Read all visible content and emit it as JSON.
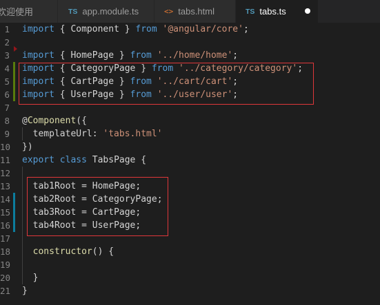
{
  "tabs": [
    {
      "label": "欢迎使用",
      "icon": "none",
      "active": false
    },
    {
      "label": "app.module.ts",
      "icon": "TS",
      "active": false
    },
    {
      "label": "tabs.html",
      "icon": "<>",
      "active": false
    },
    {
      "label": "tabs.ts",
      "icon": "TS",
      "active": true
    }
  ],
  "colors": {
    "background": "#1e1e1e",
    "keyword": "#569cd6",
    "type": "#4ec9b0",
    "string": "#ce9178",
    "function": "#dcdcaa",
    "property": "#9cdcfe",
    "highlight_box": "#e0373a"
  },
  "lines": [
    {
      "n": "1",
      "parts": [
        [
          "kw",
          "import"
        ],
        [
          "plain",
          " { "
        ],
        [
          "plain",
          "Component"
        ],
        [
          "plain",
          " } "
        ],
        [
          "kw",
          "from"
        ],
        [
          "plain",
          " "
        ],
        [
          "str",
          "'@angular/core'"
        ],
        [
          "plain",
          ";"
        ]
      ]
    },
    {
      "n": "2",
      "parts": []
    },
    {
      "n": "3",
      "parts": [
        [
          "kw",
          "import"
        ],
        [
          "plain",
          " { "
        ],
        [
          "plain",
          "HomePage"
        ],
        [
          "plain",
          " } "
        ],
        [
          "kw",
          "from"
        ],
        [
          "plain",
          " "
        ],
        [
          "str",
          "'../home/home'"
        ],
        [
          "plain",
          ";"
        ]
      ]
    },
    {
      "n": "4",
      "parts": [
        [
          "kw",
          "import"
        ],
        [
          "plain",
          " { "
        ],
        [
          "plain",
          "CategoryPage"
        ],
        [
          "plain",
          " } "
        ],
        [
          "kw",
          "from"
        ],
        [
          "plain",
          " "
        ],
        [
          "str",
          "'../category/category'"
        ],
        [
          "plain",
          ";"
        ]
      ]
    },
    {
      "n": "5",
      "parts": [
        [
          "kw",
          "import"
        ],
        [
          "plain",
          " { "
        ],
        [
          "plain",
          "CartPage"
        ],
        [
          "plain",
          " } "
        ],
        [
          "kw",
          "from"
        ],
        [
          "plain",
          " "
        ],
        [
          "str",
          "'../cart/cart'"
        ],
        [
          "plain",
          ";"
        ]
      ]
    },
    {
      "n": "6",
      "parts": [
        [
          "kw",
          "import"
        ],
        [
          "plain",
          " { "
        ],
        [
          "plain",
          "UserPage"
        ],
        [
          "plain",
          " } "
        ],
        [
          "kw",
          "from"
        ],
        [
          "plain",
          " "
        ],
        [
          "str",
          "'../user/user'"
        ],
        [
          "plain",
          ";"
        ]
      ]
    },
    {
      "n": "7",
      "parts": []
    },
    {
      "n": "8",
      "parts": [
        [
          "plain",
          "@"
        ],
        [
          "fn",
          "Component"
        ],
        [
          "plain",
          "({"
        ]
      ]
    },
    {
      "n": "9",
      "parts": [
        [
          "plain",
          "  "
        ],
        [
          "plain",
          "templateUrl"
        ],
        [
          "plain",
          ": "
        ],
        [
          "str",
          "'tabs.html'"
        ]
      ]
    },
    {
      "n": "10",
      "parts": [
        [
          "plain",
          "})"
        ]
      ]
    },
    {
      "n": "11",
      "parts": [
        [
          "kw",
          "export"
        ],
        [
          "plain",
          " "
        ],
        [
          "kw",
          "class"
        ],
        [
          "plain",
          " "
        ],
        [
          "plain",
          "TabsPage"
        ],
        [
          "plain",
          " {"
        ]
      ]
    },
    {
      "n": "12",
      "parts": []
    },
    {
      "n": "13",
      "parts": [
        [
          "plain",
          "  "
        ],
        [
          "plain",
          "tab1Root"
        ],
        [
          "plain",
          " = "
        ],
        [
          "plain",
          "HomePage"
        ],
        [
          "plain",
          ";"
        ]
      ]
    },
    {
      "n": "14",
      "parts": [
        [
          "plain",
          "  "
        ],
        [
          "plain",
          "tab2Root"
        ],
        [
          "plain",
          " = "
        ],
        [
          "plain",
          "CategoryPage"
        ],
        [
          "plain",
          ";"
        ]
      ]
    },
    {
      "n": "15",
      "parts": [
        [
          "plain",
          "  "
        ],
        [
          "plain",
          "tab3Root"
        ],
        [
          "plain",
          " = "
        ],
        [
          "plain",
          "CartPage"
        ],
        [
          "plain",
          ";"
        ]
      ]
    },
    {
      "n": "16",
      "parts": [
        [
          "plain",
          "  "
        ],
        [
          "plain",
          "tab4Root"
        ],
        [
          "plain",
          " = "
        ],
        [
          "plain",
          "UserPage"
        ],
        [
          "plain",
          ";"
        ]
      ]
    },
    {
      "n": "17",
      "parts": []
    },
    {
      "n": "18",
      "parts": [
        [
          "plain",
          "  "
        ],
        [
          "fn",
          "constructor"
        ],
        [
          "plain",
          "() {"
        ]
      ]
    },
    {
      "n": "19",
      "parts": []
    },
    {
      "n": "20",
      "parts": [
        [
          "plain",
          "  }"
        ]
      ]
    },
    {
      "n": "21",
      "parts": [
        [
          "plain",
          "}"
        ]
      ]
    }
  ]
}
